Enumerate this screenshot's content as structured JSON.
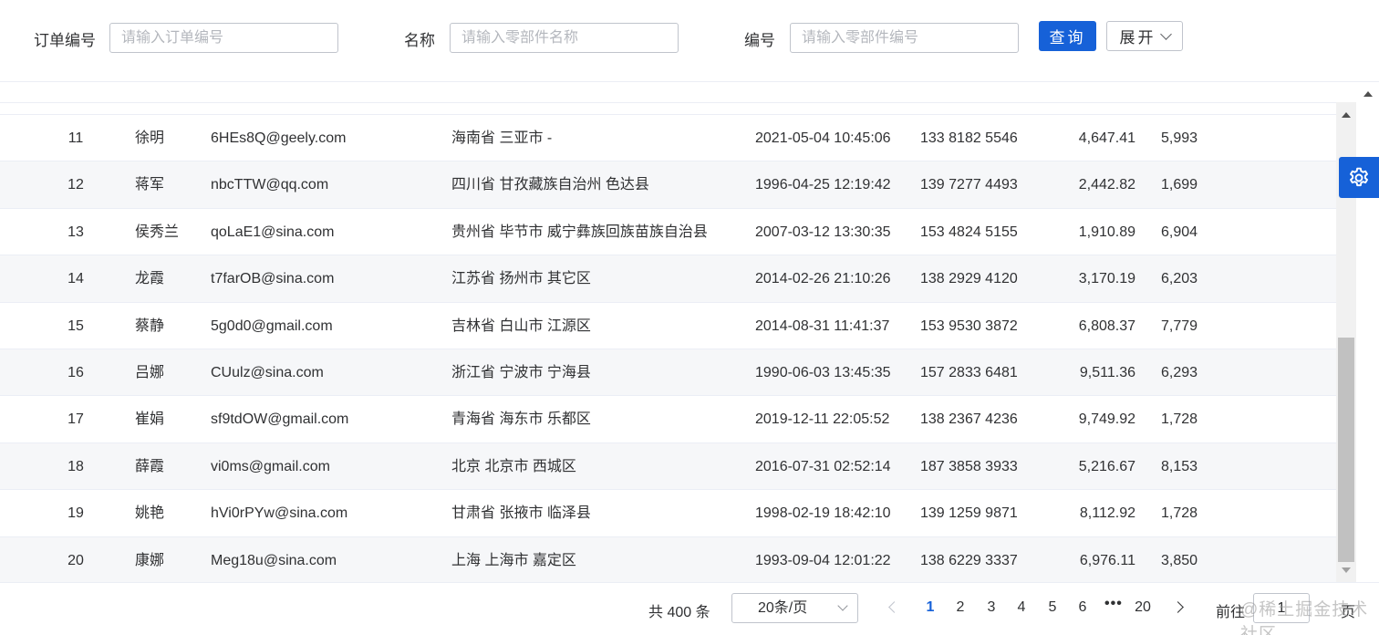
{
  "search": {
    "order_label": "订单编号",
    "order_placeholder": "请输入订单编号",
    "name_label": "名称",
    "name_placeholder": "请输入零部件名称",
    "code_label": "编号",
    "code_placeholder": "请输入零部件编号",
    "query_button": "查询",
    "expand_button": "展开"
  },
  "table": {
    "rows": [
      {
        "id": "11",
        "name": "徐明",
        "email": "6HEs8Q@geely.com",
        "address": "海南省 三亚市 -",
        "date": "2021-05-04 10:45:06",
        "phone": "133 8182 5546",
        "amount": "4,647.41",
        "count": "5,993"
      },
      {
        "id": "12",
        "name": "蒋军",
        "email": "nbcTTW@qq.com",
        "address": "四川省 甘孜藏族自治州 色达县",
        "date": "1996-04-25 12:19:42",
        "phone": "139 7277 4493",
        "amount": "2,442.82",
        "count": "1,699"
      },
      {
        "id": "13",
        "name": "侯秀兰",
        "email": "qoLaE1@sina.com",
        "address": "贵州省 毕节市 威宁彝族回族苗族自治县",
        "date": "2007-03-12 13:30:35",
        "phone": "153 4824 5155",
        "amount": "1,910.89",
        "count": "6,904"
      },
      {
        "id": "14",
        "name": "龙霞",
        "email": "t7farOB@sina.com",
        "address": "江苏省 扬州市 其它区",
        "date": "2014-02-26 21:10:26",
        "phone": "138 2929 4120",
        "amount": "3,170.19",
        "count": "6,203"
      },
      {
        "id": "15",
        "name": "蔡静",
        "email": "5g0d0@gmail.com",
        "address": "吉林省 白山市 江源区",
        "date": "2014-08-31 11:41:37",
        "phone": "153 9530 3872",
        "amount": "6,808.37",
        "count": "7,779"
      },
      {
        "id": "16",
        "name": "吕娜",
        "email": "CUulz@sina.com",
        "address": "浙江省 宁波市 宁海县",
        "date": "1990-06-03 13:45:35",
        "phone": "157 2833 6481",
        "amount": "9,511.36",
        "count": "6,293"
      },
      {
        "id": "17",
        "name": "崔娟",
        "email": "sf9tdOW@gmail.com",
        "address": "青海省 海东市 乐都区",
        "date": "2019-12-11 22:05:52",
        "phone": "138 2367 4236",
        "amount": "9,749.92",
        "count": "1,728"
      },
      {
        "id": "18",
        "name": "薛霞",
        "email": "vi0ms@gmail.com",
        "address": "北京 北京市 西城区",
        "date": "2016-07-31 02:52:14",
        "phone": "187 3858 3933",
        "amount": "5,216.67",
        "count": "8,153"
      },
      {
        "id": "19",
        "name": "姚艳",
        "email": "hVi0rPYw@sina.com",
        "address": "甘肃省 张掖市 临泽县",
        "date": "1998-02-19 18:42:10",
        "phone": "139 1259 9871",
        "amount": "8,112.92",
        "count": "1,728"
      },
      {
        "id": "20",
        "name": "康娜",
        "email": "Meg18u@sina.com",
        "address": "上海 上海市 嘉定区",
        "date": "1993-09-04 12:01:22",
        "phone": "138 6229 3337",
        "amount": "6,976.11",
        "count": "3,850"
      }
    ]
  },
  "pagination": {
    "total": "共 400 条",
    "page_size": "20条/页",
    "pages": [
      "1",
      "2",
      "3",
      "4",
      "5",
      "6"
    ],
    "current_page": "1",
    "more": "•••",
    "last_page": "20",
    "goto_label": "前往",
    "goto_value": "1",
    "page_suffix": "页"
  },
  "watermark": "@稀土掘金技术社区",
  "colors": {
    "primary": "#1661d8",
    "stripe": "#f6f7f9",
    "border": "#ebeef5"
  },
  "icons": {
    "settings": "gear-icon",
    "prev": "chevron-left-icon",
    "next": "chevron-right-icon",
    "dropdown": "chevron-down-icon"
  }
}
